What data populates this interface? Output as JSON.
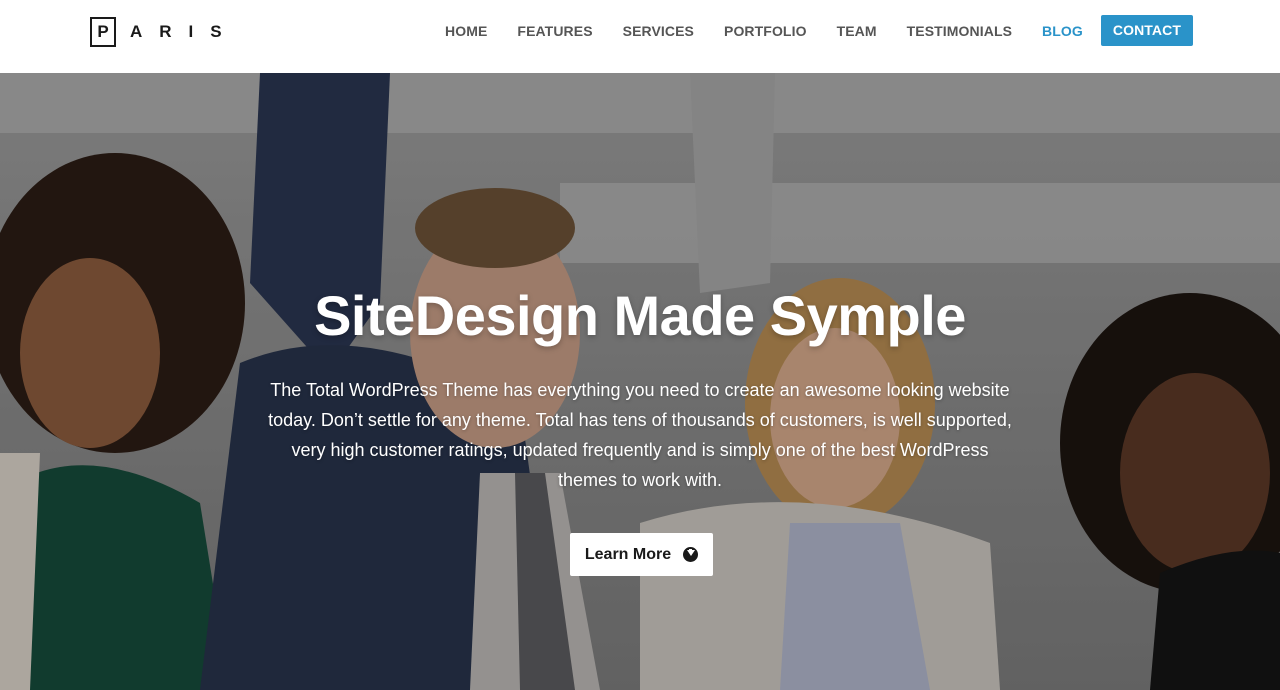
{
  "brand": {
    "first_letter": "P",
    "rest": "ARIS"
  },
  "nav": {
    "items": [
      {
        "label": "HOME"
      },
      {
        "label": "FEATURES"
      },
      {
        "label": "SERVICES"
      },
      {
        "label": "PORTFOLIO"
      },
      {
        "label": "TEAM"
      },
      {
        "label": "TESTIMONIALS"
      },
      {
        "label": "BLOG",
        "active": true
      }
    ],
    "contact_label": "CONTACT"
  },
  "hero": {
    "title": "SiteDesign Made Symple",
    "text": "The Total WordPress Theme has everything you need to create an awesome looking website today. Don’t settle for any theme. Total has tens of thousands of customers, is well supported, very high customer ratings, updated frequently and is simply one of the best WordPress themes to work with.",
    "button_label": "Learn More",
    "button_icon": "arrow-circle-down-icon"
  },
  "colors": {
    "accent": "#2a93c9",
    "nav_text": "#555555"
  }
}
